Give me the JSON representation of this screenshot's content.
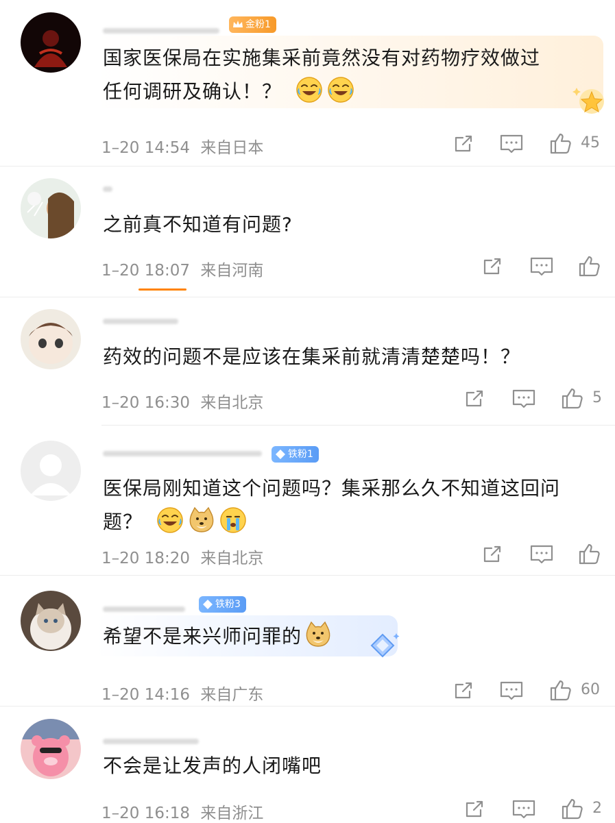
{
  "badges": {
    "gold1": "金粉1",
    "iron1": "铁粉1",
    "iron3": "铁粉3"
  },
  "comments": [
    {
      "text_line1": "国家医保局在实施集采前竟然没有对药物疗效做过",
      "text_line2": "任何调研及确认！？",
      "time": "1–20 14:54",
      "location": "来自日本",
      "likes": "45"
    },
    {
      "text_line1": "之前真不知道有问题?",
      "time": "1–20 18:07",
      "location": "来自河南",
      "likes": ""
    },
    {
      "text_line1": "药效的问题不是应该在集采前就清清楚楚吗！？",
      "time": "1–20 16:30",
      "location": "来自北京",
      "likes": "5"
    },
    {
      "text_line1": "医保局刚知道这个问题吗？集采那么久不知道这回问",
      "text_line2": "题？",
      "time": "1–20 18:20",
      "location": "来自北京",
      "likes": ""
    },
    {
      "text_line1": "希望不是来兴师问罪的",
      "time": "1–20 14:16",
      "location": "来自广东",
      "likes": "60"
    },
    {
      "text_line1": "不会是让发声的人闭嘴吧",
      "time": "1–20 16:18",
      "location": "来自浙江",
      "likes": "2"
    }
  ],
  "icons": {
    "share": "share-icon",
    "reply": "comment-icon",
    "like": "like-icon"
  }
}
